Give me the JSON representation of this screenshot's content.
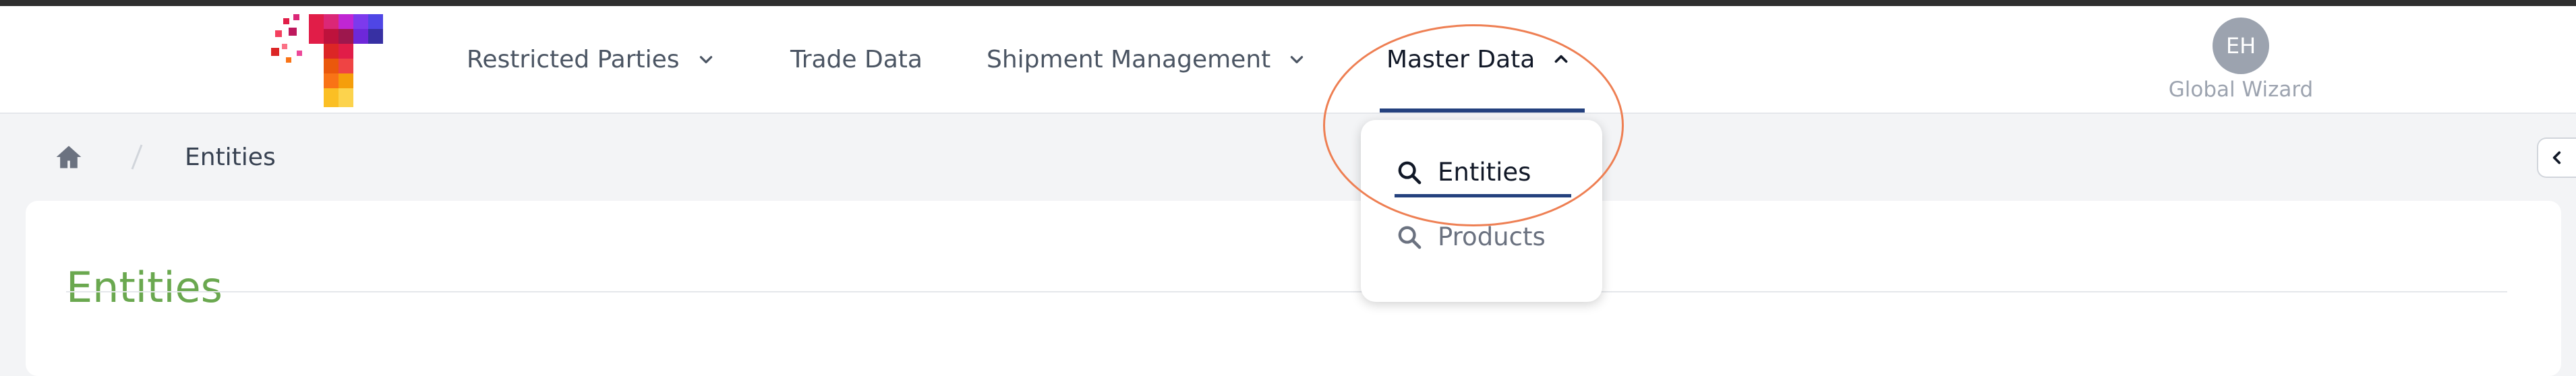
{
  "colors": {
    "accent": "#24417e",
    "title_green": "#6aa84f",
    "highlight": "#ee7f53",
    "avatar_bg": "#9ca3af"
  },
  "nav": {
    "items": [
      {
        "label": "Restricted Parties",
        "has_dropdown": true
      },
      {
        "label": "Trade Data",
        "has_dropdown": false
      },
      {
        "label": "Shipment Management",
        "has_dropdown": true
      },
      {
        "label": "Master Data",
        "has_dropdown": true,
        "active": true,
        "expanded": true
      }
    ]
  },
  "master_data_menu": {
    "items": [
      {
        "label": "Entities",
        "icon": "search-icon",
        "active": true
      },
      {
        "label": "Products",
        "icon": "search-icon",
        "active": false
      }
    ]
  },
  "user": {
    "initials": "EH",
    "name": "Global Wizard"
  },
  "breadcrumb": {
    "home_icon": "home-icon",
    "current": "Entities"
  },
  "page": {
    "title": "Entities"
  }
}
